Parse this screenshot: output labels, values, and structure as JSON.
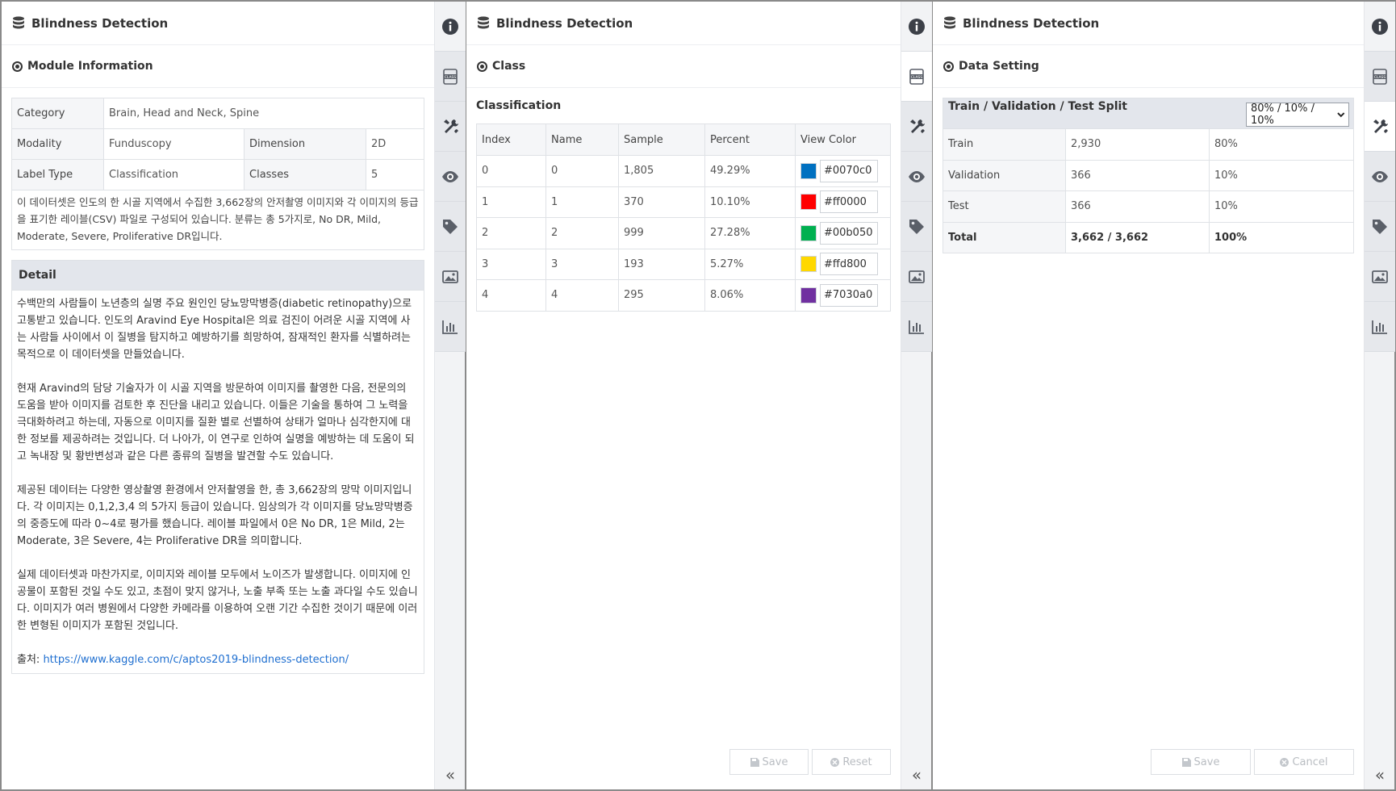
{
  "app_title": "Blindness Detection",
  "panel1": {
    "section": "Module Information",
    "info": {
      "category_label": "Category",
      "category_value": "Brain, Head and Neck, Spine",
      "modality_label": "Modality",
      "modality_value": "Funduscopy",
      "dimension_label": "Dimension",
      "dimension_value": "2D",
      "label_type_label": "Label Type",
      "label_type_value": "Classification",
      "classes_label": "Classes",
      "classes_value": "5"
    },
    "description": "이 데이터셋은 인도의 한 시골 지역에서 수집한 3,662장의 안저촬영 이미지와 각 이미지의 등급을 표기한 레이블(CSV) 파일로 구성되어 있습니다. 분류는 총 5가지로, No DR, Mild, Moderate, Severe, Proliferative DR입니다.",
    "detail_title": "Detail",
    "detail_paragraphs": [
      "수백만의 사람들이 노년층의 실명 주요 원인인 당뇨망막병증(diabetic retinopathy)으로 고통받고 있습니다. 인도의  Aravind Eye Hospital은 의료 검진이 어려운 시골 지역에 사는 사람들 사이에서 이 질병을 탐지하고 예방하기를 희망하여, 잠재적인 환자를 식별하려는 목적으로 이 데이터셋을 만들었습니다.",
      "현재 Aravind의 담당 기술자가 이 시골 지역을 방문하여 이미지를 촬영한 다음, 전문의의 도움을 받아 이미지를 검토한 후 진단을 내리고 있습니다. 이들은 기술을 통하여 그 노력을 극대화하려고 하는데, 자동으로 이미지를 질환 별로 선별하여 상태가 얼마나 심각한지에 대한 정보를 제공하려는 것입니다. 더 나아가, 이 연구로 인하여 실명을 예방하는 데 도움이 되고 녹내장 및 황반변성과 같은 다른 종류의 질병을 발견할 수도 있습니다.",
      "제공된 데이터는 다양한 영상촬영 환경에서 안저촬영을 한, 총 3,662장의 망막 이미지입니다. 각 이미지는 0,1,2,3,4 의 5가지 등급이 있습니다. 임상의가 각 이미지를 당뇨망막병증의 중증도에 따라 0~4로 평가를 했습니다. 레이블 파일에서 0은 No DR, 1은 Mild, 2는 Moderate, 3은 Severe, 4는 Proliferative DR을 의미합니다.",
      "실제 데이터셋과 마찬가지로, 이미지와 레이블 모두에서 노이즈가 발생합니다. 이미지에 인공물이 포함된 것일 수도 있고, 초점이 맞지 않거나, 노출 부족 또는 노출 과다일 수도 있습니다. 이미지가 여러 병원에서 다양한 카메라를 이용하여 오랜 기간 수집한 것이기 때문에 이러한 변형된 이미지가 포함된 것입니다."
    ],
    "source_label": "출처: ",
    "source_link": "https://www.kaggle.com/c/aptos2019-blindness-detection/"
  },
  "panel2": {
    "section": "Class",
    "subtitle": "Classification",
    "headers": [
      "Index",
      "Name",
      "Sample",
      "Percent",
      "View Color"
    ],
    "rows": [
      {
        "index": "0",
        "name": "0",
        "sample": "1,805",
        "percent": "49.29%",
        "color": "#0070c0"
      },
      {
        "index": "1",
        "name": "1",
        "sample": "370",
        "percent": "10.10%",
        "color": "#ff0000"
      },
      {
        "index": "2",
        "name": "2",
        "sample": "999",
        "percent": "27.28%",
        "color": "#00b050"
      },
      {
        "index": "3",
        "name": "3",
        "sample": "193",
        "percent": "5.27%",
        "color": "#ffd800"
      },
      {
        "index": "4",
        "name": "4",
        "sample": "295",
        "percent": "8.06%",
        "color": "#7030a0"
      }
    ],
    "save_label": "Save",
    "reset_label": "Reset"
  },
  "panel3": {
    "section": "Data Setting",
    "split_title": "Train / Validation / Test Split",
    "split_selected": "80% / 10% / 10%",
    "rows": [
      {
        "name": "Train",
        "count": "2,930",
        "percent": "80%"
      },
      {
        "name": "Validation",
        "count": "366",
        "percent": "10%"
      },
      {
        "name": "Test",
        "count": "366",
        "percent": "10%"
      }
    ],
    "total": {
      "name": "Total",
      "count": "3,662 / 3,662",
      "percent": "100%"
    },
    "save_label": "Save",
    "cancel_label": "Cancel"
  },
  "colors": {
    "rail_bg": "#f2f3f5",
    "header_bg": "#e3e6ec",
    "link": "#1f6fd0",
    "disabled_text": "#b9bdc2"
  },
  "icons": [
    "database-icon",
    "info-icon",
    "class-icon",
    "tools-icon",
    "eye-icon",
    "tag-icon",
    "image-icon",
    "chart-icon",
    "double-chevron-left-icon",
    "save-icon",
    "reset-icon",
    "cancel-icon"
  ]
}
